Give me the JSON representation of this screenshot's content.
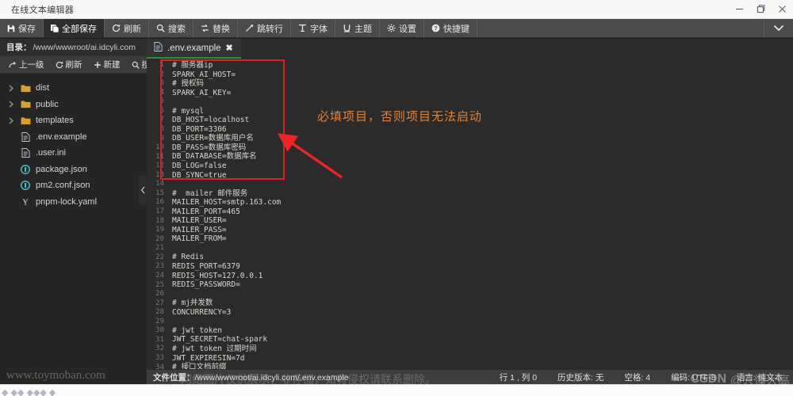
{
  "window": {
    "title": "在线文本编辑器",
    "controls": [
      {
        "name": "minimize",
        "glyph": "minimize-icon"
      },
      {
        "name": "maximize",
        "glyph": "maximize-icon"
      },
      {
        "name": "close",
        "glyph": "close-icon"
      }
    ]
  },
  "toolbar": {
    "items": [
      {
        "label": "保存",
        "icon": "save-icon",
        "active": false
      },
      {
        "label": "全部保存",
        "icon": "save-all-icon",
        "active": true
      },
      {
        "label": "刷新",
        "icon": "refresh-icon",
        "active": false
      },
      {
        "label": "搜索",
        "icon": "search-icon",
        "active": false
      },
      {
        "label": "替换",
        "icon": "replace-icon",
        "active": false
      },
      {
        "label": "跳转行",
        "icon": "goto-line-icon",
        "active": false
      },
      {
        "label": "字体",
        "icon": "font-icon",
        "active": false
      },
      {
        "label": "主题",
        "icon": "theme-icon",
        "active": false
      },
      {
        "label": "设置",
        "icon": "gear-icon",
        "active": false
      },
      {
        "label": "快捷键",
        "icon": "help-icon",
        "active": false
      }
    ],
    "overflow_icon": "chevron-down-icon"
  },
  "sidebar": {
    "dir_label": "目录：",
    "dir_path": "/www/wwwroot/ai.idcyli.com",
    "actions": [
      {
        "label": "上一级",
        "icon": "arrow-up-level-icon"
      },
      {
        "label": "刷新",
        "icon": "refresh-icon"
      },
      {
        "label": "新建",
        "icon": "plus-icon"
      },
      {
        "label": "搜索",
        "icon": "search-icon"
      }
    ],
    "files": [
      {
        "label": "dist",
        "type": "folder",
        "expandable": true
      },
      {
        "label": "public",
        "type": "folder",
        "expandable": true
      },
      {
        "label": "templates",
        "type": "folder",
        "expandable": true
      },
      {
        "label": ".env.example",
        "type": "file",
        "expandable": false
      },
      {
        "label": ".user.ini",
        "type": "file",
        "expandable": false
      },
      {
        "label": "package.json",
        "type": "json",
        "expandable": false
      },
      {
        "label": "pm2.conf.json",
        "type": "json",
        "expandable": false
      },
      {
        "label": "pnpm-lock.yaml",
        "type": "yaml",
        "expandable": false
      }
    ],
    "collapse_icon": "chevron-left-icon"
  },
  "editor": {
    "tab": {
      "label": ".env.example",
      "icon": "file-icon",
      "close_icon": "close-icon"
    },
    "first_line": 1,
    "lines": [
      "# 服务器ip",
      "SPARK_AI_HOST=",
      "# 授权码",
      "SPARK_AI_KEY=",
      "",
      "# mysql",
      "DB_HOST=localhost",
      "DB_PORT=3306",
      "DB_USER=数据库用户名",
      "DB_PASS=数据库密码",
      "DB_DATABASE=数据库名",
      "DB_LOG=false",
      "DB_SYNC=true",
      "",
      "#  mailer 邮件服务",
      "MAILER_HOST=smtp.163.com",
      "MAILER_PORT=465",
      "MAILER_USER=",
      "MAILER_PASS=",
      "MAILER_FROM=",
      "",
      "# Redis",
      "REDIS_PORT=6379",
      "REDIS_HOST=127.0.0.1",
      "REDIS_PASSWORD=",
      "",
      "# mj并发数",
      "CONCURRENCY=3",
      "",
      "# jwt token",
      "JWT_SECRET=chat-spark",
      "# jwt token 过期时间",
      "JWT_EXPIRESIN=7d",
      "# 接口文档前缀"
    ]
  },
  "annotation": {
    "text": "必填项目，否则项目无法启动",
    "text_color": "#e2833a",
    "box_color": "#e02020",
    "arrow_color": "#ee2323"
  },
  "statusbar": {
    "file_location_label": "文件位置：",
    "file_location_path": "/www/wwwroot/ai.idcyli.com/.env.example",
    "cells": [
      "行 1 , 列 0",
      "历史版本: 无",
      "空格: 4",
      "编码: UTF-8",
      "语言: 纯文本"
    ]
  },
  "watermark": {
    "site": "www.toymoban.com",
    "notice": "网络图片仅供展示，非存储，如有侵权请联系删除。",
    "csdn": "CSDN",
    "cn": "@只懂大高"
  }
}
